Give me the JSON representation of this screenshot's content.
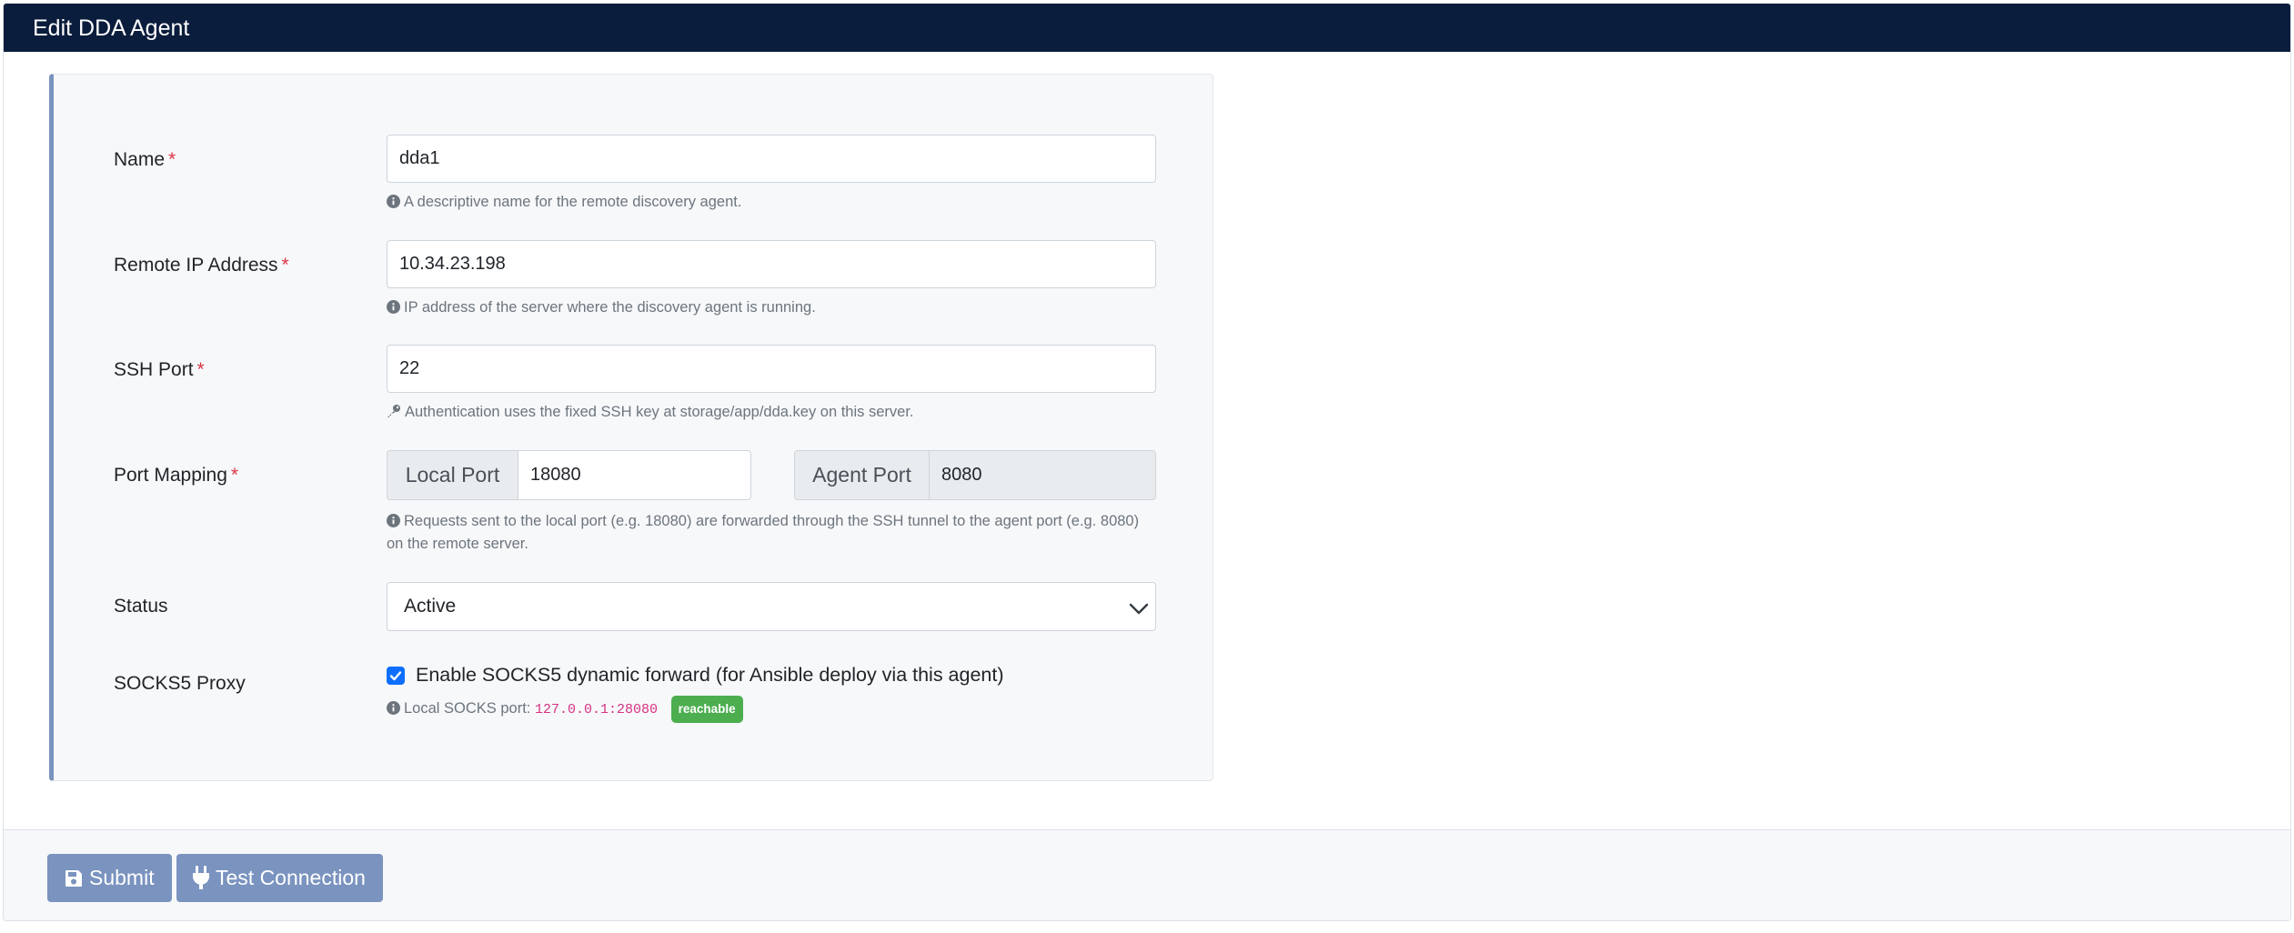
{
  "header": {
    "title": "Edit DDA Agent"
  },
  "form": {
    "required_mark": "*",
    "name": {
      "label": "Name",
      "value": "dda1",
      "help": "A descriptive name for the remote discovery agent."
    },
    "remote_ip": {
      "label": "Remote IP Address",
      "value": "10.34.23.198",
      "help": "IP address of the server where the discovery agent is running."
    },
    "ssh_port": {
      "label": "SSH Port",
      "value": "22",
      "help": "Authentication uses the fixed SSH key at storage/app/dda.key on this server."
    },
    "port_mapping": {
      "label": "Port Mapping",
      "local_label": "Local Port",
      "local_value": "18080",
      "agent_label": "Agent Port",
      "agent_value": "8080",
      "help": "Requests sent to the local port (e.g. 18080) are forwarded through the SSH tunnel to the agent port (e.g. 8080) on the remote server."
    },
    "status": {
      "label": "Status",
      "selected": "Active"
    },
    "socks": {
      "label": "SOCKS5 Proxy",
      "checked": true,
      "checkbox_label": "Enable SOCKS5 dynamic forward (for Ansible deploy via this agent)",
      "help_prefix": "Local SOCKS port:",
      "address": "127.0.0.1:28080",
      "badge": "reachable",
      "badge_color": "#4cae4f"
    }
  },
  "footer": {
    "submit_label": "Submit",
    "test_label": "Test Connection"
  },
  "colors": {
    "header_bg": "#0b1d3c",
    "accent": "#7a93bf",
    "required": "#dc3545",
    "checkbox": "#0d6efd"
  }
}
